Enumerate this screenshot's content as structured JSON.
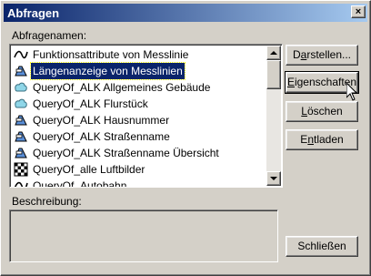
{
  "window": {
    "title": "Abfragen",
    "close_label": "×"
  },
  "list_label": "Abfragenamen:",
  "queries": [
    {
      "label": "Funktionsattribute von Messlinie",
      "icon": "line-icon",
      "selected": false
    },
    {
      "label": "Längenanzeige von Messlinien",
      "icon": "road-sign-icon",
      "selected": true
    },
    {
      "label": "QueryOf_ALK Allgemeines Gebäude",
      "icon": "polygon-icon",
      "selected": false
    },
    {
      "label": "QueryOf_ALK Flurstück",
      "icon": "polygon-icon",
      "selected": false
    },
    {
      "label": "QueryOf_ALK Hausnummer",
      "icon": "road-sign-icon",
      "selected": false
    },
    {
      "label": "QueryOf_ALK Straßenname",
      "icon": "road-sign-icon",
      "selected": false
    },
    {
      "label": "QueryOf_ALK Straßenname Übersicht",
      "icon": "road-sign-icon",
      "selected": false
    },
    {
      "label": "QueryOf_alle Luftbilder",
      "icon": "raster-icon",
      "selected": false
    },
    {
      "label": "QueryOf_Autobahn",
      "icon": "line-icon",
      "selected": false
    }
  ],
  "description_label": "Beschreibung:",
  "description_text": "",
  "buttons": {
    "create": {
      "pre": "D",
      "mn": "a",
      "post": "rstellen..."
    },
    "properties": {
      "pre": "",
      "mn": "E",
      "post": "igenschaften"
    },
    "delete": {
      "pre": "",
      "mn": "L",
      "post": "öschen"
    },
    "unload": {
      "pre": "E",
      "mn": "n",
      "post": "tladen"
    },
    "close": {
      "pre": "",
      "mn": "",
      "post": "Schließen"
    }
  },
  "colors": {
    "title_start": "#0a246a",
    "title_end": "#a6caf0",
    "selection": "#0a246a",
    "face": "#d4d0c8"
  }
}
